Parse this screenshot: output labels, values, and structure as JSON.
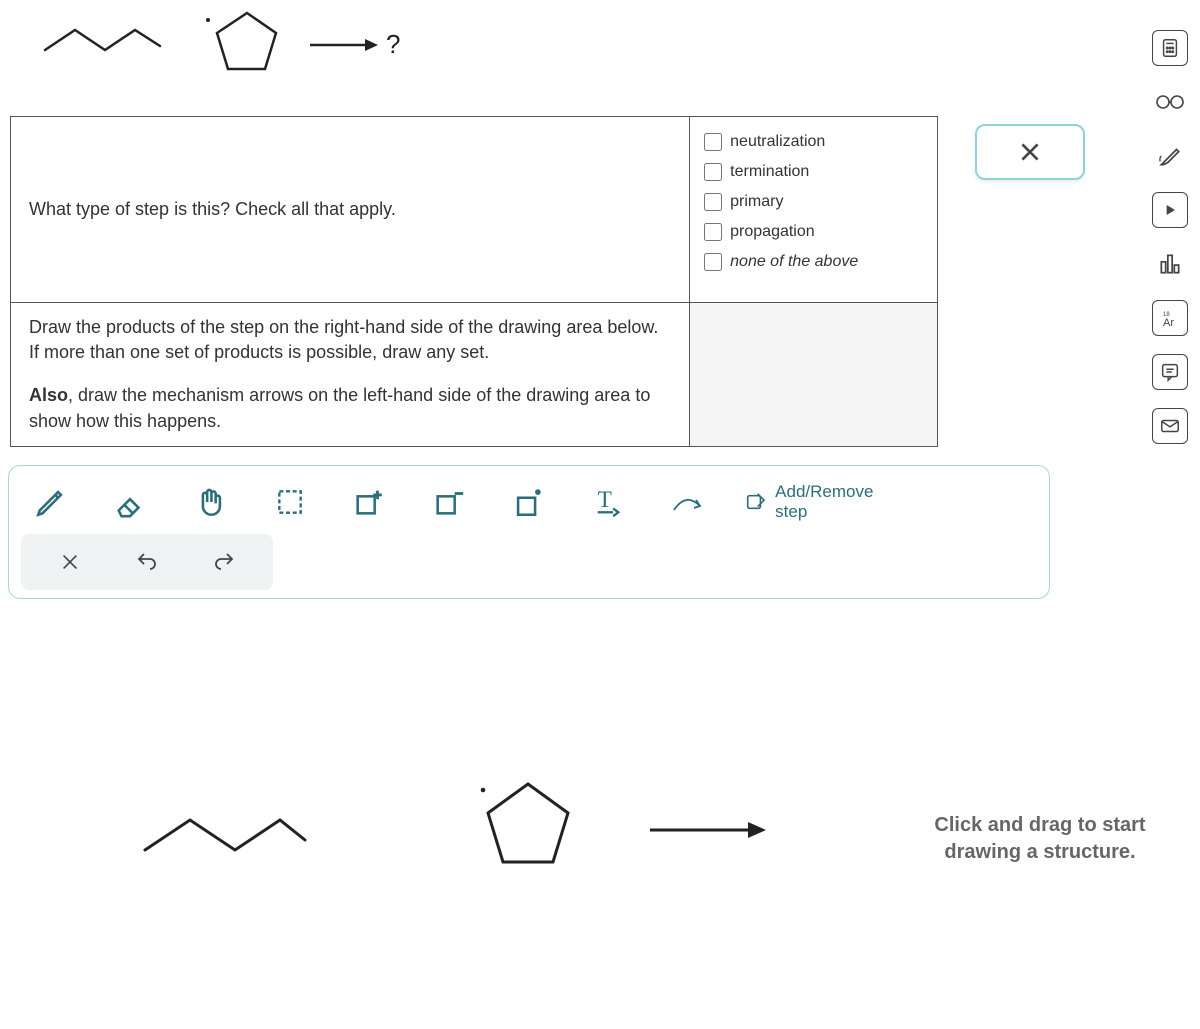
{
  "reaction": {
    "product_placeholder": "?"
  },
  "question1": {
    "prompt": "What type of step is this? Check all that apply.",
    "options": [
      {
        "label": "neutralization",
        "italic": false
      },
      {
        "label": "termination",
        "italic": false
      },
      {
        "label": "primary",
        "italic": false
      },
      {
        "label": "propagation",
        "italic": false
      },
      {
        "label": "none of the above",
        "italic": true
      }
    ]
  },
  "question2": {
    "para1": "Draw the products of the step on the right-hand side of the drawing area below. If more than one set of products is possible, draw any set.",
    "para2_bold": "Also",
    "para2_rest": ", draw the mechanism arrows on the left-hand side of the drawing area to show how this happens."
  },
  "toolbar": {
    "add_remove_label": "Add/Remove step"
  },
  "hint": {
    "line1": "Click and drag to start",
    "line2": "drawing a structure."
  },
  "icons": {
    "pencil": "pencil-icon",
    "eraser": "eraser-icon",
    "hand": "hand-icon",
    "marquee": "marquee-icon",
    "charge_plus": "charge-plus-icon",
    "charge_minus": "charge-minus-icon",
    "radical": "radical-icon",
    "text": "text-label-icon",
    "curved_arrow": "curved-arrow-icon",
    "edit_square": "edit-square-icon",
    "close": "close-icon",
    "undo": "undo-icon",
    "redo": "redo-icon"
  },
  "rail": {
    "calculator": "calculator-icon",
    "glasses": "glasses-icon",
    "highlight": "highlighter-icon",
    "video": "play-video-icon",
    "bars": "bar-chart-icon",
    "periodic": "periodic-table-icon",
    "feedback": "feedback-icon",
    "mail": "mail-icon"
  }
}
